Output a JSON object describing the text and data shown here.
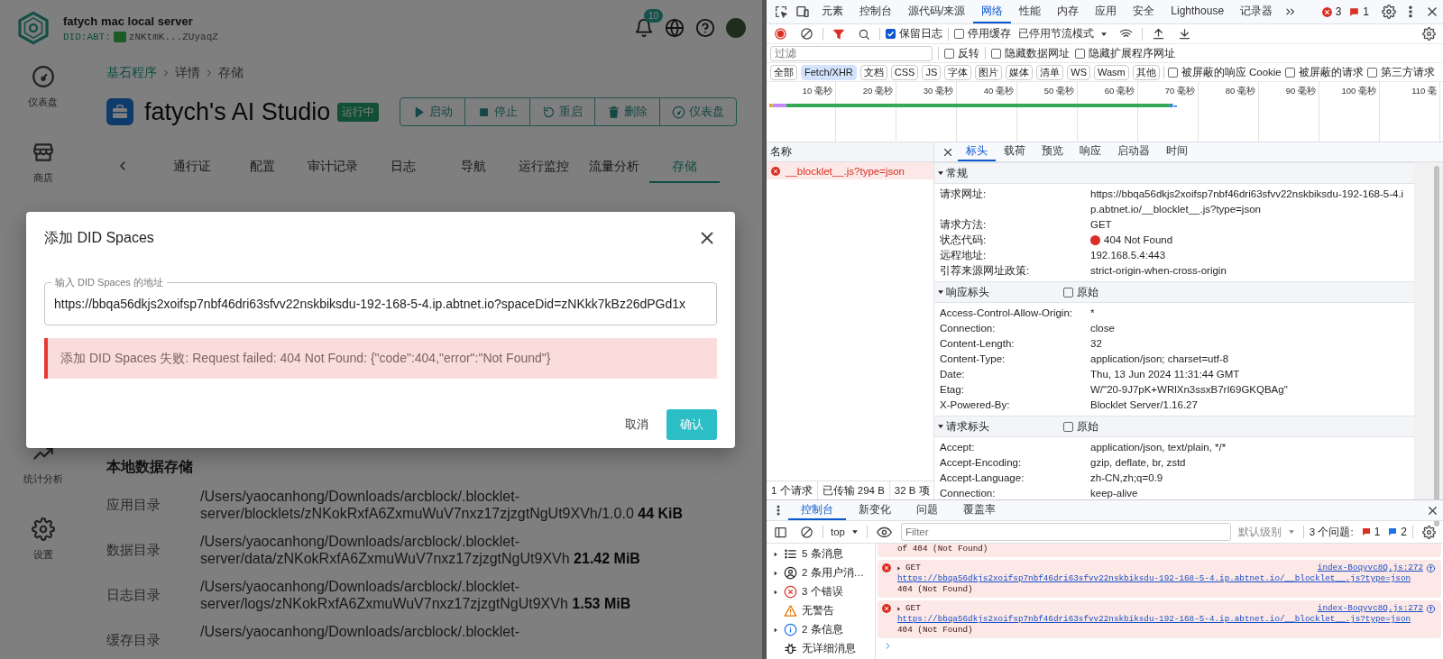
{
  "header": {
    "title": "fatych mac local server",
    "did_label": "DID:ABT:",
    "did": "zNKtmK...ZUyaqZ",
    "notification_count": "10"
  },
  "sidebar": {
    "items": [
      {
        "label": "仪表盘"
      },
      {
        "label": "商店"
      },
      {
        "label": "统计分析"
      },
      {
        "label": "设置"
      }
    ]
  },
  "breadcrumb": [
    "基石程序",
    "详情",
    "存储"
  ],
  "app": {
    "name": "fatych's AI Studio",
    "status": "运行中",
    "actions": [
      "启动",
      "停止",
      "重启",
      "删除",
      "仪表盘"
    ]
  },
  "tabs": [
    {
      "label": "通行证",
      "selected": false
    },
    {
      "label": "配置",
      "selected": false
    },
    {
      "label": "审计记录",
      "selected": false
    },
    {
      "label": "日志",
      "selected": false
    },
    {
      "label": "导航",
      "selected": false
    },
    {
      "label": "运行监控",
      "selected": false
    },
    {
      "label": "流量分析",
      "selected": false
    },
    {
      "label": "存储",
      "selected": true
    }
  ],
  "storage": {
    "title": "本地数据存储",
    "rows": [
      {
        "label": "应用目录",
        "path": "/Users/yaocanhong/Downloads/arcblock/.blocklet-server/blocklets/zNKokRxfA6ZxmuWuV7nxz17zjzgtNgUt9XVh/1.0.0 **44 KiB**"
      },
      {
        "label": "数据目录",
        "path": "/Users/yaocanhong/Downloads/arcblock/.blocklet-server/data/zNKokRxfA6ZxmuWuV7nxz17zjzgtNgUt9XVh **21.42 MiB**"
      },
      {
        "label": "日志目录",
        "path": "/Users/yaocanhong/Downloads/arcblock/.blocklet-server/logs/zNKokRxfA6ZxmuWuV7nxz17zjzgtNgUt9XVh **1.53 MiB**"
      },
      {
        "label": "缓存目录",
        "path": "/Users/yaocanhong/Downloads/arcblock/.blocklet-"
      }
    ]
  },
  "dialog": {
    "title": "添加 DID Spaces",
    "field": {
      "label": "输入 DID Spaces 的地址",
      "value": "https://bbqa56dkjs2xoifsp7nbf46dri63sfvv22nskbiksdu-192-168-5-4.ip.abtnet.io?spaceDid=zNKkk7kBz26dPGd1x"
    },
    "error": "添加 DID Spaces 失败: Request failed: 404 Not Found: {\"code\":404,\"error\":\"Not Found\"}",
    "buttons": [
      {
        "label": "取消",
        "kind": "text"
      },
      {
        "label": "确认",
        "kind": "primary"
      }
    ]
  },
  "devtools": {
    "tabs": [
      {
        "label": "元素",
        "selected": false
      },
      {
        "label": "控制台",
        "selected": false
      },
      {
        "label": "源代码/来源",
        "selected": false
      },
      {
        "label": "网络",
        "selected": true
      },
      {
        "label": "性能",
        "selected": false
      },
      {
        "label": "内存",
        "selected": false
      },
      {
        "label": "应用",
        "selected": false
      },
      {
        "label": "安全",
        "selected": false
      },
      {
        "label": "Lighthouse",
        "selected": false
      },
      {
        "label": "记录器",
        "selected": false
      }
    ],
    "error_count": "3",
    "issue_count": "1",
    "network": {
      "preserve_log": {
        "label": "保留日志",
        "checked": true
      },
      "disable_cache": {
        "label": "停用缓存",
        "checked": false
      },
      "throttling": "已停用节流模式",
      "filter_placeholder": "过滤",
      "filter_options": [
        {
          "label": "反转",
          "checked": false
        },
        {
          "label": "隐藏数据网址",
          "checked": false
        },
        {
          "label": "隐藏扩展程序网址",
          "checked": false
        }
      ],
      "types": [
        {
          "label": "全部",
          "selected": false
        },
        {
          "label": "Fetch/XHR",
          "selected": true
        },
        {
          "label": "文档",
          "selected": false
        },
        {
          "label": "CSS",
          "selected": false
        },
        {
          "label": "JS",
          "selected": false
        },
        {
          "label": "字体",
          "selected": false
        },
        {
          "label": "图片",
          "selected": false
        },
        {
          "label": "媒体",
          "selected": false
        },
        {
          "label": "清单",
          "selected": false
        },
        {
          "label": "WS",
          "selected": false
        },
        {
          "label": "Wasm",
          "selected": false
        },
        {
          "label": "其他",
          "selected": false
        }
      ],
      "type_options": [
        {
          "label": "被屏蔽的响应 Cookie",
          "checked": false
        },
        {
          "label": "被屏蔽的请求",
          "checked": false
        },
        {
          "label": "第三方请求",
          "checked": false
        }
      ],
      "timeline_ticks": [
        "10 毫秒",
        "20 毫秒",
        "30 毫秒",
        "40 毫秒",
        "50 毫秒",
        "60 毫秒",
        "70 毫秒",
        "80 毫秒",
        "90 毫秒",
        "100 毫秒",
        "110 毫"
      ],
      "name_header": "名称",
      "requests": [
        {
          "name": "__blocklet__.js?type=json",
          "selected": true,
          "failed": true
        }
      ],
      "summary": [
        "1 个请求",
        "已传输 294 B",
        "32 B 项"
      ],
      "detail_tabs": [
        {
          "label": "标头",
          "selected": true
        },
        {
          "label": "载荷",
          "selected": false
        },
        {
          "label": "预览",
          "selected": false
        },
        {
          "label": "响应",
          "selected": false
        },
        {
          "label": "启动器",
          "selected": false
        },
        {
          "label": "时间",
          "selected": false
        }
      ],
      "sections": [
        {
          "title": "常规",
          "expanded": true,
          "rows": [
            {
              "name": "请求网址:",
              "value": "https://bbqa56dkjs2xoifsp7nbf46dri63sfvv22nskbiksdu-192-168-5-4.ip.abtnet.io/__blocklet__.js?type=json",
              "kind": "text"
            },
            {
              "name": "请求方法:",
              "value": "GET",
              "kind": "text"
            },
            {
              "name": "状态代码:",
              "value": "404 Not Found",
              "kind": "status"
            },
            {
              "name": "远程地址:",
              "value": "192.168.5.4:443",
              "kind": "text"
            },
            {
              "name": "引荐来源网址政策:",
              "value": "strict-origin-when-cross-origin",
              "kind": "text"
            }
          ]
        },
        {
          "title": "响应标头",
          "expanded": true,
          "raw": {
            "label": "原始",
            "checked": false
          },
          "rows": [
            {
              "name": "Access-Control-Allow-Origin:",
              "value": "*",
              "kind": "text"
            },
            {
              "name": "Connection:",
              "value": "close",
              "kind": "text"
            },
            {
              "name": "Content-Length:",
              "value": "32",
              "kind": "text"
            },
            {
              "name": "Content-Type:",
              "value": "application/json; charset=utf-8",
              "kind": "text"
            },
            {
              "name": "Date:",
              "value": "Thu, 13 Jun 2024 11:31:44 GMT",
              "kind": "text"
            },
            {
              "name": "Etag:",
              "value": "W/\"20-9J7pK+WRlXn3ssxB7rI69GKQBAg\"",
              "kind": "text"
            },
            {
              "name": "X-Powered-By:",
              "value": "Blocklet Server/1.16.27",
              "kind": "text"
            }
          ]
        },
        {
          "title": "请求标头",
          "expanded": true,
          "raw": {
            "label": "原始",
            "checked": false
          },
          "rows": [
            {
              "name": "Accept:",
              "value": "application/json, text/plain, */*",
              "kind": "text"
            },
            {
              "name": "Accept-Encoding:",
              "value": "gzip, deflate, br, zstd",
              "kind": "text"
            },
            {
              "name": "Accept-Language:",
              "value": "zh-CN,zh;q=0.9",
              "kind": "text"
            },
            {
              "name": "Connection:",
              "value": "keep-alive",
              "kind": "text"
            }
          ]
        }
      ]
    },
    "console": {
      "tabs": [
        {
          "label": "控制台",
          "selected": true
        },
        {
          "label": "新变化",
          "selected": false
        },
        {
          "label": "问题",
          "selected": false
        },
        {
          "label": "覆盖率",
          "selected": false
        }
      ],
      "context": "top",
      "filter_placeholder": "Filter",
      "level": "默认级别",
      "issues_label": "3 个问题:",
      "issue_errors": "1",
      "issue_infos": "2",
      "sidebar": [
        {
          "label": "5 条消息",
          "expandable": true
        },
        {
          "label": "2 条用户消…",
          "expandable": true
        },
        {
          "label": "3 个错误",
          "expandable": true
        },
        {
          "label": "无警告",
          "expandable": false
        },
        {
          "label": "2 条信息",
          "expandable": true
        },
        {
          "label": "无详细消息",
          "expandable": false
        }
      ],
      "messages": [
        {
          "kind": "text",
          "text": "of 404 (Not Found)"
        },
        {
          "kind": "request",
          "method": "GET",
          "url": "https://bbqa56dkjs2xoifsp7nbf46dri63sfvv22nskbiksdu-192-168-5-4.ip.abtnet.io/__blocklet__.js?type=json",
          "status": "404 (Not Found)",
          "source": "index-Boqyvc8Q.js:272"
        },
        {
          "kind": "request",
          "method": "GET",
          "url": "https://bbqa56dkjs2xoifsp7nbf46dri63sfvv22nskbiksdu-192-168-5-4.ip.abtnet.io/__blocklet__.js?type=json",
          "status": "404 (Not Found)",
          "source": "index-Boqyvc8Q.js:272"
        }
      ]
    }
  }
}
